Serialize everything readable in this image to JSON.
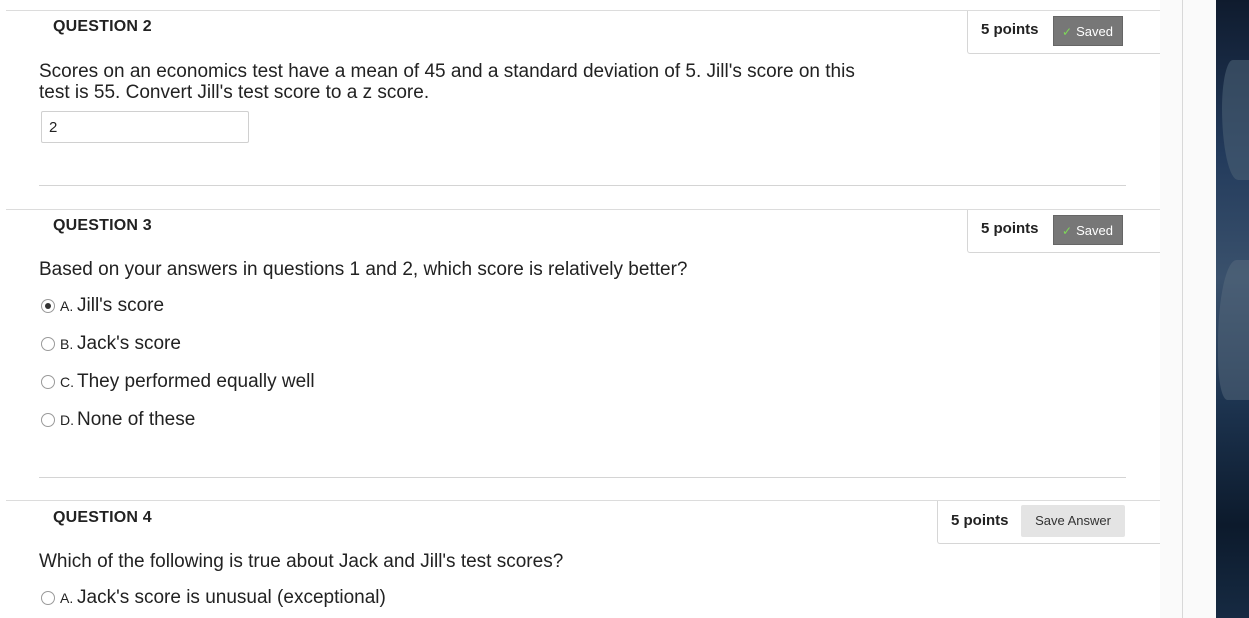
{
  "questions": [
    {
      "title": "QUESTION 2",
      "points": "5 points",
      "status": "Saved",
      "text_line1": "Scores on an economics test have a mean of 45 and a standard deviation of 5. Jill's score on this",
      "text_line2": "test is 55. Convert Jill's test score to a z score.",
      "answer_value": "2"
    },
    {
      "title": "QUESTION 3",
      "points": "5 points",
      "status": "Saved",
      "text": "Based on your answers in questions 1 and 2, which score is relatively better?",
      "options": [
        {
          "letter": "A.",
          "text": "Jill's score",
          "selected": true
        },
        {
          "letter": "B.",
          "text": "Jack's score",
          "selected": false
        },
        {
          "letter": "C.",
          "text": "They performed equally well",
          "selected": false
        },
        {
          "letter": "D.",
          "text": "None of these",
          "selected": false
        }
      ]
    },
    {
      "title": "QUESTION 4",
      "points": "5 points",
      "save_label": "Save Answer",
      "text": "Which of the following is true about  Jack and Jill's test scores?",
      "options": [
        {
          "letter": "A.",
          "text": "Jack's score is unusual (exceptional)",
          "selected": false
        }
      ]
    }
  ],
  "icons": {
    "saved_check": "check-icon",
    "radio": "radio-icon"
  },
  "colors": {
    "saved_bg": "#777777",
    "check": "#7ed957",
    "save_btn_bg": "#e4e4e4"
  }
}
